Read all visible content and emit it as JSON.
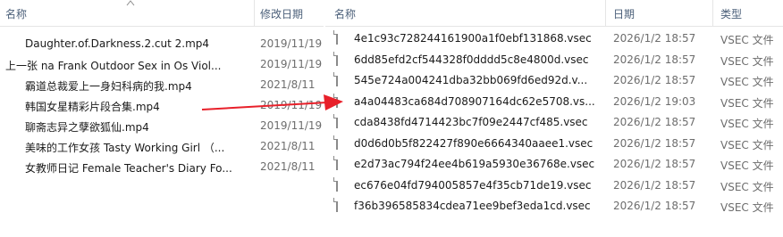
{
  "left_explorer": {
    "columns": {
      "name": "名称",
      "modified": "修改日期"
    },
    "rows": [
      {
        "icon": "video-file-icon",
        "name": "Daughter.of.Darkness.2.cut 2.mp4",
        "date": "2019/11/19"
      },
      {
        "icon": "none",
        "name": "上一张    na Frank Outdoor Sex in Os Viol...",
        "date": "2019/11/19"
      },
      {
        "icon": "video-file-icon",
        "name": "霸道总裁爱上一身妇科病的我.mp4",
        "date": "2021/8/11"
      },
      {
        "icon": "video-file-icon",
        "name": "韩国女星精彩片段合集.mp4",
        "date": "2019/11/19"
      },
      {
        "icon": "video-file-icon",
        "name": "聊斋志异之孽欲狐仙.mp4",
        "date": "2019/11/19"
      },
      {
        "icon": "video-file-icon",
        "name": "美味的工作女孩 Tasty Working Girl （...",
        "date": "2021/8/11"
      },
      {
        "icon": "video-file-icon",
        "name": "女教师日记 Female Teacher's Diary Fo...",
        "date": "2021/8/11"
      }
    ]
  },
  "right_explorer": {
    "columns": {
      "name": "名称",
      "date": "日期",
      "type": "类型"
    },
    "rows": [
      {
        "icon": "blank-file-icon",
        "name": "4e1c93c728244161900a1f0ebf131868.vsec",
        "date": "2026/1/2 18:57",
        "type": "VSEC 文件"
      },
      {
        "icon": "blank-file-icon",
        "name": "6dd85efd2cf544328f0dddd5c8e4800d.vsec",
        "date": "2026/1/2 18:57",
        "type": "VSEC 文件"
      },
      {
        "icon": "blank-file-icon",
        "name": "545e724a004241dba32bb069fd6ed92d.v...",
        "date": "2026/1/2 18:57",
        "type": "VSEC 文件"
      },
      {
        "icon": "blank-file-icon",
        "name": "a4a04483ca684d708907164dc62e5708.vs...",
        "date": "2026/1/2 19:03",
        "type": "VSEC 文件"
      },
      {
        "icon": "blank-file-icon",
        "name": "cda8438fd4714423bc7f09e2447cf485.vsec",
        "date": "2026/1/2 18:57",
        "type": "VSEC 文件"
      },
      {
        "icon": "blank-file-icon",
        "name": "d0d6d0b5f822427f890e6664340aaee1.vsec",
        "date": "2026/1/2 18:57",
        "type": "VSEC 文件"
      },
      {
        "icon": "blank-file-icon",
        "name": "e2d73ac794f24ee4b619a5930e36768e.vsec",
        "date": "2026/1/2 18:57",
        "type": "VSEC 文件"
      },
      {
        "icon": "blank-file-icon",
        "name": "ec676e04fd794005857e4f35cb71de19.vsec",
        "date": "2026/1/2 18:57",
        "type": "VSEC 文件"
      },
      {
        "icon": "blank-file-icon",
        "name": "f36b396585834cdea71ee9bef3eda1cd.vsec",
        "date": "2026/1/2 18:57",
        "type": "VSEC 文件"
      }
    ]
  },
  "colors": {
    "arrow": "#e8202a",
    "header_text": "#4c607a",
    "video_icon": "#f7c531"
  }
}
